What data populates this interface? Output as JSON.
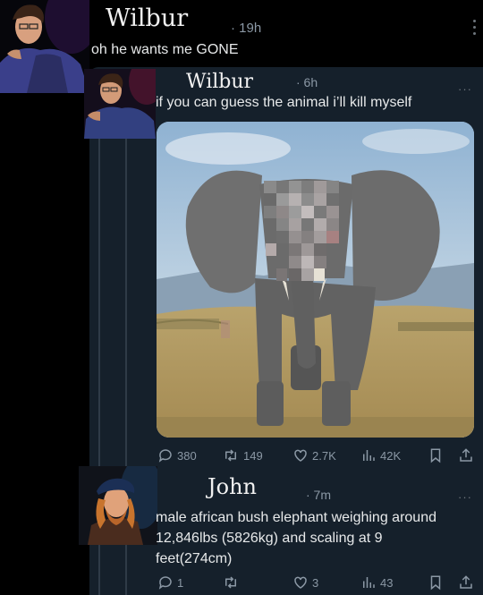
{
  "top_tweet": {
    "name": "Wilbur",
    "time": "· 19h",
    "text": "oh  he wants me GONE"
  },
  "quoted_tweet": {
    "name": "Wilbur",
    "time": "· 6h",
    "more": "···",
    "text": "if you can guess the animal i’ll kill myself",
    "stats": {
      "replies": "380",
      "retweets": "149",
      "likes": "2.7K",
      "views": "42K"
    }
  },
  "reply_tweet": {
    "name": "John",
    "time": "· 7m",
    "more": "···",
    "text_lines": [
      "male african bush elephant weighing around",
      "12,846lbs (5826kg) and scaling at 9",
      "feet(274cm)"
    ],
    "stats": {
      "replies": "1",
      "retweets": "",
      "likes": "3",
      "views": "43"
    }
  },
  "icons": {
    "reply": "speech-bubble-icon",
    "retweet": "retweet-icon",
    "like": "heart-icon",
    "views": "bar-chart-icon",
    "bookmark": "bookmark-icon",
    "share": "share-icon",
    "more": "ellipsis-icon"
  },
  "colors": {
    "background": "#000000",
    "card": "#15202b",
    "muted": "#8b98a5",
    "text": "#e7e9ea"
  }
}
